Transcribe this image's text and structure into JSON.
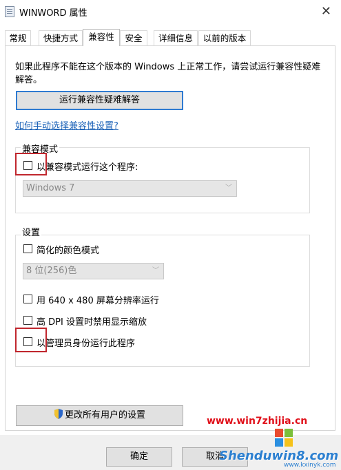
{
  "window": {
    "title": "WINWORD 属性",
    "close_icon": "close-icon"
  },
  "tabs": [
    {
      "label": "常规"
    },
    {
      "label": "快捷方式"
    },
    {
      "label": "兼容性",
      "active": true
    },
    {
      "label": "安全"
    },
    {
      "label": "详细信息"
    },
    {
      "label": "以前的版本"
    }
  ],
  "intro_text": "如果此程序不能在这个版本的 Windows 上正常工作，请尝试运行兼容性疑难解答。",
  "troubleshooter_button": "运行兼容性疑难解答",
  "manual_link": "如何手动选择兼容性设置?",
  "compat_mode": {
    "legend": "兼容模式",
    "checkbox_label": "以兼容模式运行这个程序:",
    "checked": false,
    "os_select_value": "Windows 7"
  },
  "settings": {
    "legend": "设置",
    "reduced_color_label": "简化的颜色模式",
    "color_select_value": "8 位(256)色",
    "resolution_label": "用 640 x 480 屏幕分辨率运行",
    "dpi_label": "高 DPI 设置时禁用显示缩放",
    "admin_label": "以管理员身份运行此程序"
  },
  "all_users_button": "更改所有用户的设置",
  "footer": {
    "ok": "确定",
    "cancel": "取消"
  },
  "watermark": {
    "site1": "www.win7zhijia.cn",
    "site2": "Shenduwin8.com",
    "site3": "www.kxinyk.com"
  },
  "colors": {
    "highlight": "#c0262d",
    "link": "#1d63b8",
    "focus_border": "#2f7bd1"
  }
}
